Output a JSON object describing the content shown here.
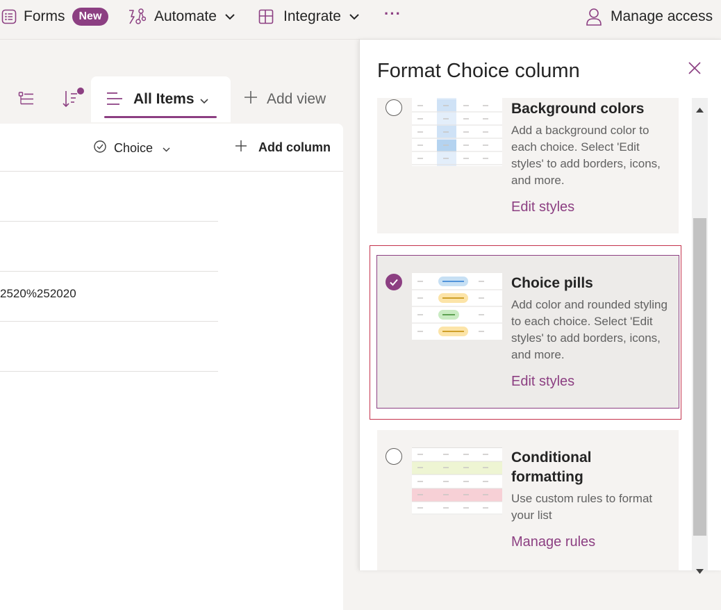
{
  "topbar": {
    "forms_label": "Forms",
    "new_badge": "New",
    "automate_label": "Automate",
    "integrate_label": "Integrate",
    "more_label": "···",
    "manage_access_label": "Manage access"
  },
  "view": {
    "active_tab": "All Items",
    "add_view_label": "Add view",
    "sort_has_indicator": true
  },
  "grid": {
    "columns": [
      {
        "label": "Choice"
      },
      {
        "label": "Add column"
      }
    ],
    "rows": [
      {
        "text": ""
      },
      {
        "text": ""
      },
      {
        "text": "2520%252020"
      },
      {
        "text": ""
      }
    ]
  },
  "panel": {
    "title": "Format Choice column",
    "options": [
      {
        "title": "Background colors",
        "description": "Add a background color to each choice. Select 'Edit styles' to add borders, icons, and more.",
        "link": "Edit styles",
        "selected": false
      },
      {
        "title": "Choice pills",
        "description": "Add color and rounded styling to each choice. Select 'Edit styles' to add borders, icons, and more.",
        "link": "Edit styles",
        "selected": true
      },
      {
        "title": "Conditional formatting",
        "description": "Use custom rules to format your list",
        "link": "Manage rules",
        "selected": false
      }
    ]
  },
  "colors": {
    "accent": "#8c3f82",
    "focus_border": "#c4314b",
    "pill_blue": "#c7e0f4",
    "pill_yellow": "#fce4a8",
    "pill_green": "#c9ebc2",
    "row_green": "#eef5d3",
    "row_red": "#f7d0d6"
  }
}
